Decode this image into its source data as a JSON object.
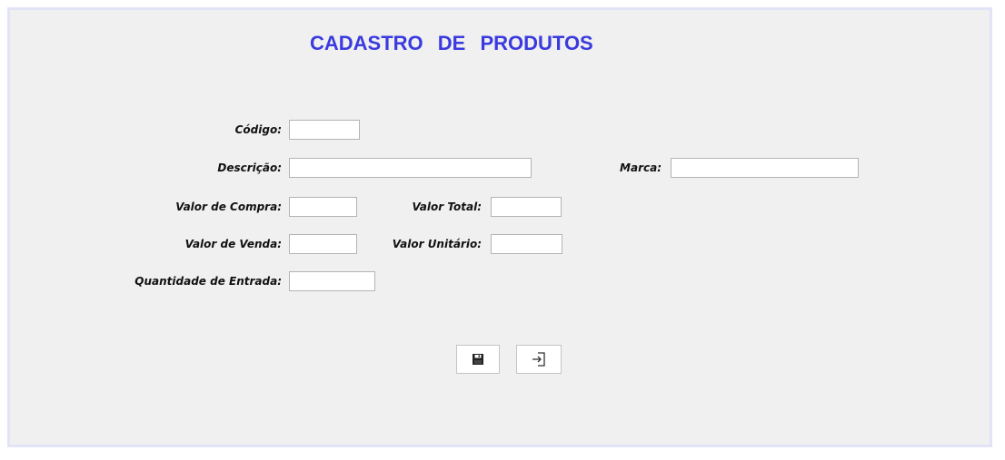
{
  "form": {
    "title": "CADASTRO  DE  PRODUTOS",
    "title_color": "#3a3ae0",
    "fields": {
      "codigo": {
        "label": "Código:",
        "value": ""
      },
      "descricao": {
        "label": "Descrição:",
        "value": ""
      },
      "marca": {
        "label": "Marca:",
        "value": ""
      },
      "valor_compra": {
        "label": "Valor de Compra:",
        "value": ""
      },
      "valor_total": {
        "label": "Valor Total:",
        "value": ""
      },
      "valor_venda": {
        "label": "Valor de Venda:",
        "value": ""
      },
      "valor_unitario": {
        "label": "Valor Unitário:",
        "value": ""
      },
      "quantidade_entrada": {
        "label": "Quantidade de Entrada:",
        "value": ""
      }
    },
    "buttons": {
      "save_icon": "floppy-disk-icon",
      "exit_icon": "exit-arrow-icon"
    }
  }
}
